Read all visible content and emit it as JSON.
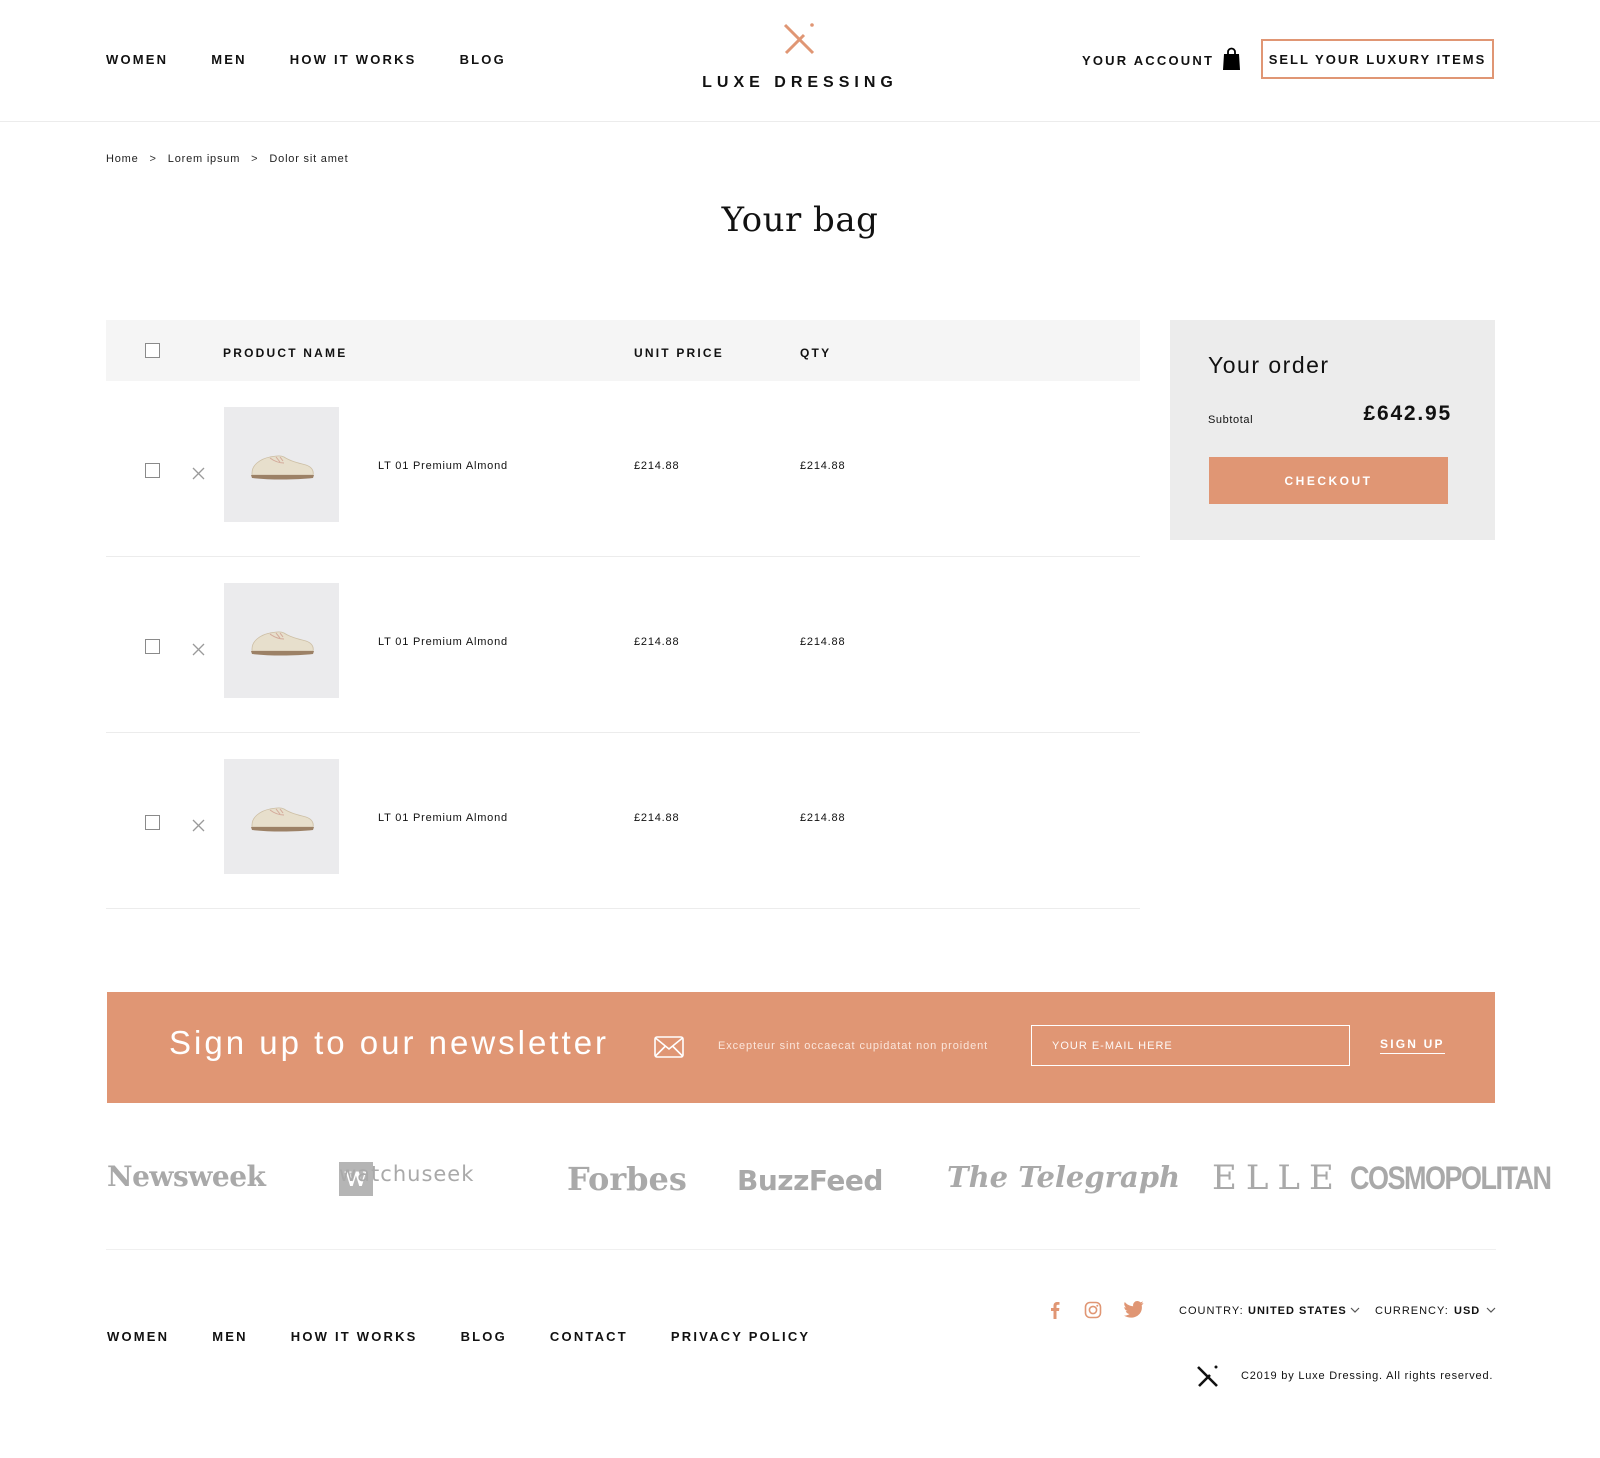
{
  "header": {
    "nav": [
      "WOMEN",
      "MEN",
      "HOW IT WORKS",
      "BLOG"
    ],
    "logo_text": "LUXE DRESSING",
    "account": "YOUR ACCOUNT",
    "sell_button": "SELL YOUR LUXURY ITEMS",
    "icons": {
      "logo": "luxe-dressing-logo-icon",
      "bag": "shopping-bag-icon"
    }
  },
  "breadcrumb": [
    "Home",
    "Lorem ipsum",
    "Dolor sit amet"
  ],
  "breadcrumb_separator": ">",
  "page_title": "Your bag",
  "cart": {
    "headers": {
      "product": "PRODUCT NAME",
      "unit_price": "UNIT PRICE",
      "qty": "QTY"
    },
    "items": [
      {
        "name": "LT 01 Premium Almond",
        "unit_price": "£214.88",
        "qty": "£214.88",
        "checked": false
      },
      {
        "name": "LT 01 Premium Almond",
        "unit_price": "£214.88",
        "qty": "£214.88",
        "checked": false
      },
      {
        "name": "LT 01 Premium Almond",
        "unit_price": "£214.88",
        "qty": "£214.88",
        "checked": false
      }
    ]
  },
  "order": {
    "title": "Your order",
    "subtotal_label": "Subtotal",
    "subtotal_value": "£642.95",
    "checkout": "CHECKOUT"
  },
  "newsletter": {
    "title": "Sign up to our newsletter",
    "text": "Excepteur sint occaecat cupidatat non proident",
    "placeholder": "YOUR E-MAIL HERE",
    "signup": "SIGN UP",
    "icon": "envelope-icon"
  },
  "press": {
    "newsweek": "Newsweek",
    "watchuseek_mark": "W",
    "watchuseek": "watchuseek",
    "forbes": "Forbes",
    "buzzfeed": "BuzzFeed",
    "telegraph": "The Telegraph",
    "elle": "ELLE",
    "cosmopolitan": "COSMOPOLITAN"
  },
  "footer": {
    "nav": [
      "WOMEN",
      "MEN",
      "HOW IT WORKS",
      "BLOG",
      "CONTACT",
      "PRIVACY POLICY"
    ],
    "social_icons": [
      "facebook-icon",
      "instagram-icon",
      "twitter-icon"
    ],
    "country_label": "COUNTRY:",
    "country_value": "UNITED STATES",
    "currency_label": "CURRENCY:",
    "currency_value": "USD",
    "copyright": "C2019 by Luxe Dressing. All rights reserved."
  },
  "colors": {
    "accent": "#e09674",
    "text": "#111111",
    "table_header_bg": "#f5f5f5",
    "order_bg": "#ececec",
    "thumb_bg": "#ebebed",
    "press_logo": "#a9a9a9"
  }
}
